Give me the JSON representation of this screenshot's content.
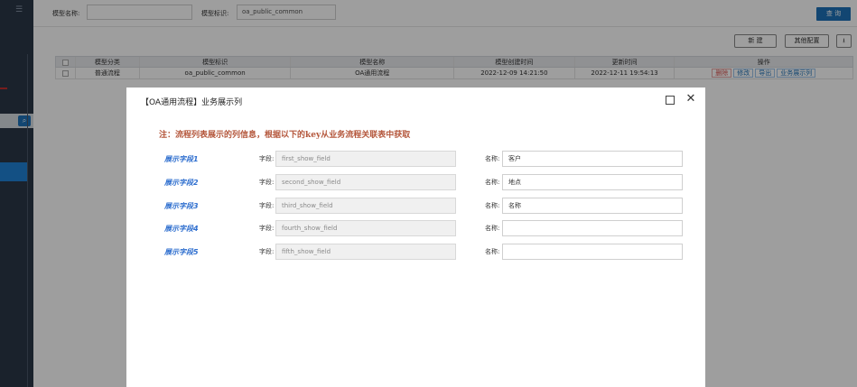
{
  "sidebar": {
    "menu_icon": "☰",
    "search_icon": "🔍"
  },
  "filter": {
    "model_name_label": "模型名称:",
    "model_name_value": "",
    "model_id_label": "模型标识:",
    "model_id_value": "oa_public_common",
    "query_label": "查 询"
  },
  "toolbar": {
    "new_label": "新 建",
    "other_config_label": "其他配置",
    "upload_icon": "⭳"
  },
  "table": {
    "headers": [
      "模型分类",
      "模型标识",
      "模型名称",
      "模型创建时间",
      "更新时间",
      "操作"
    ],
    "rows": [
      {
        "category": "普通流程",
        "model_id": "oa_public_common",
        "model_name": "OA通用流程",
        "created": "2022-12-09 14:21:50",
        "updated": "2022-12-11 19:54:13",
        "actions": [
          "删除",
          "修改",
          "导出",
          "业务展示列"
        ]
      }
    ]
  },
  "modal": {
    "title": "【OA通用流程】业务展示列",
    "close_symbol": "✕",
    "note": "注：流程列表展示的列信息，根据以下的key从业务流程关联表中获取",
    "field_label": "字段:",
    "name_label": "名称:",
    "rows": [
      {
        "label": "展示字段1",
        "field": "first_show_field",
        "name": "客户"
      },
      {
        "label": "展示字段2",
        "field": "second_show_field",
        "name": "地点"
      },
      {
        "label": "展示字段3",
        "field": "third_show_field",
        "name": "名称"
      },
      {
        "label": "展示字段4",
        "field": "fourth_show_field",
        "name": ""
      },
      {
        "label": "展示字段5",
        "field": "fifth_show_field",
        "name": ""
      }
    ]
  },
  "colors": {
    "sidebar_bg": "#2b3848",
    "primary": "#1d72b8",
    "note_color": "#b4563b",
    "row_label_color": "#2f6fcf",
    "danger": "#d9534f"
  }
}
